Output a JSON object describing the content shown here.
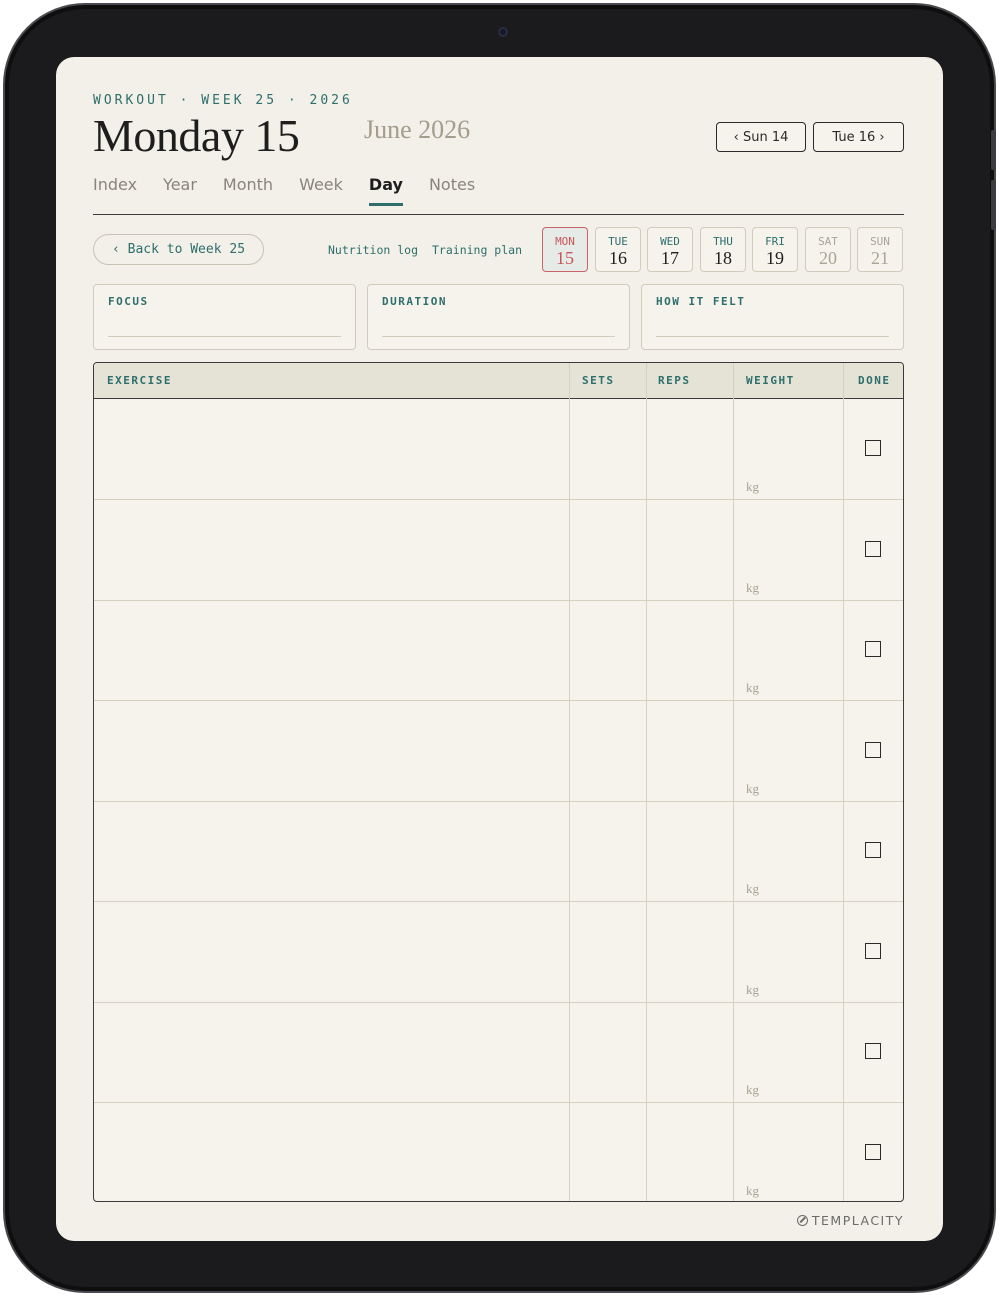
{
  "header": {
    "kicker": "WORKOUT · WEEK 25 · 2026",
    "title": "Monday 15",
    "subtitle": "June 2026",
    "prev_day": "‹  Sun 14",
    "next_day": "Tue 16  ›"
  },
  "tabs": [
    {
      "label": "Index"
    },
    {
      "label": "Year"
    },
    {
      "label": "Month"
    },
    {
      "label": "Week"
    },
    {
      "label": "Day",
      "active": true
    },
    {
      "label": "Notes"
    }
  ],
  "toolbar": {
    "back_label": "‹  Back to Week 25",
    "nutrition_link": "Nutrition log",
    "training_link": "Training plan"
  },
  "week_days": [
    {
      "name": "MON",
      "num": "15",
      "state": "active"
    },
    {
      "name": "TUE",
      "num": "16",
      "state": "normal"
    },
    {
      "name": "WED",
      "num": "17",
      "state": "normal"
    },
    {
      "name": "THU",
      "num": "18",
      "state": "normal"
    },
    {
      "name": "FRI",
      "num": "19",
      "state": "normal"
    },
    {
      "name": "SAT",
      "num": "20",
      "state": "weekend"
    },
    {
      "name": "SUN",
      "num": "21",
      "state": "weekend"
    }
  ],
  "fields": {
    "focus": "FOCUS",
    "duration": "DURATION",
    "how_it_felt": "HOW IT FELT"
  },
  "table": {
    "headers": {
      "exercise": "EXERCISE",
      "sets": "SETS",
      "reps": "REPS",
      "weight": "WEIGHT",
      "done": "DONE"
    },
    "unit": "kg",
    "rows": [
      {
        "exercise": "",
        "sets": "",
        "reps": "",
        "weight": "",
        "done": false
      },
      {
        "exercise": "",
        "sets": "",
        "reps": "",
        "weight": "",
        "done": false
      },
      {
        "exercise": "",
        "sets": "",
        "reps": "",
        "weight": "",
        "done": false
      },
      {
        "exercise": "",
        "sets": "",
        "reps": "",
        "weight": "",
        "done": false
      },
      {
        "exercise": "",
        "sets": "",
        "reps": "",
        "weight": "",
        "done": false
      },
      {
        "exercise": "",
        "sets": "",
        "reps": "",
        "weight": "",
        "done": false
      },
      {
        "exercise": "",
        "sets": "",
        "reps": "",
        "weight": "",
        "done": false
      },
      {
        "exercise": "",
        "sets": "",
        "reps": "",
        "weight": "",
        "done": false
      }
    ]
  },
  "brand": "TEMPLACITY",
  "colors": {
    "accent": "#2e6f6c",
    "active_day": "#c9555b",
    "paper": "#f2f0e8",
    "bezel": "#1b1b1d"
  }
}
